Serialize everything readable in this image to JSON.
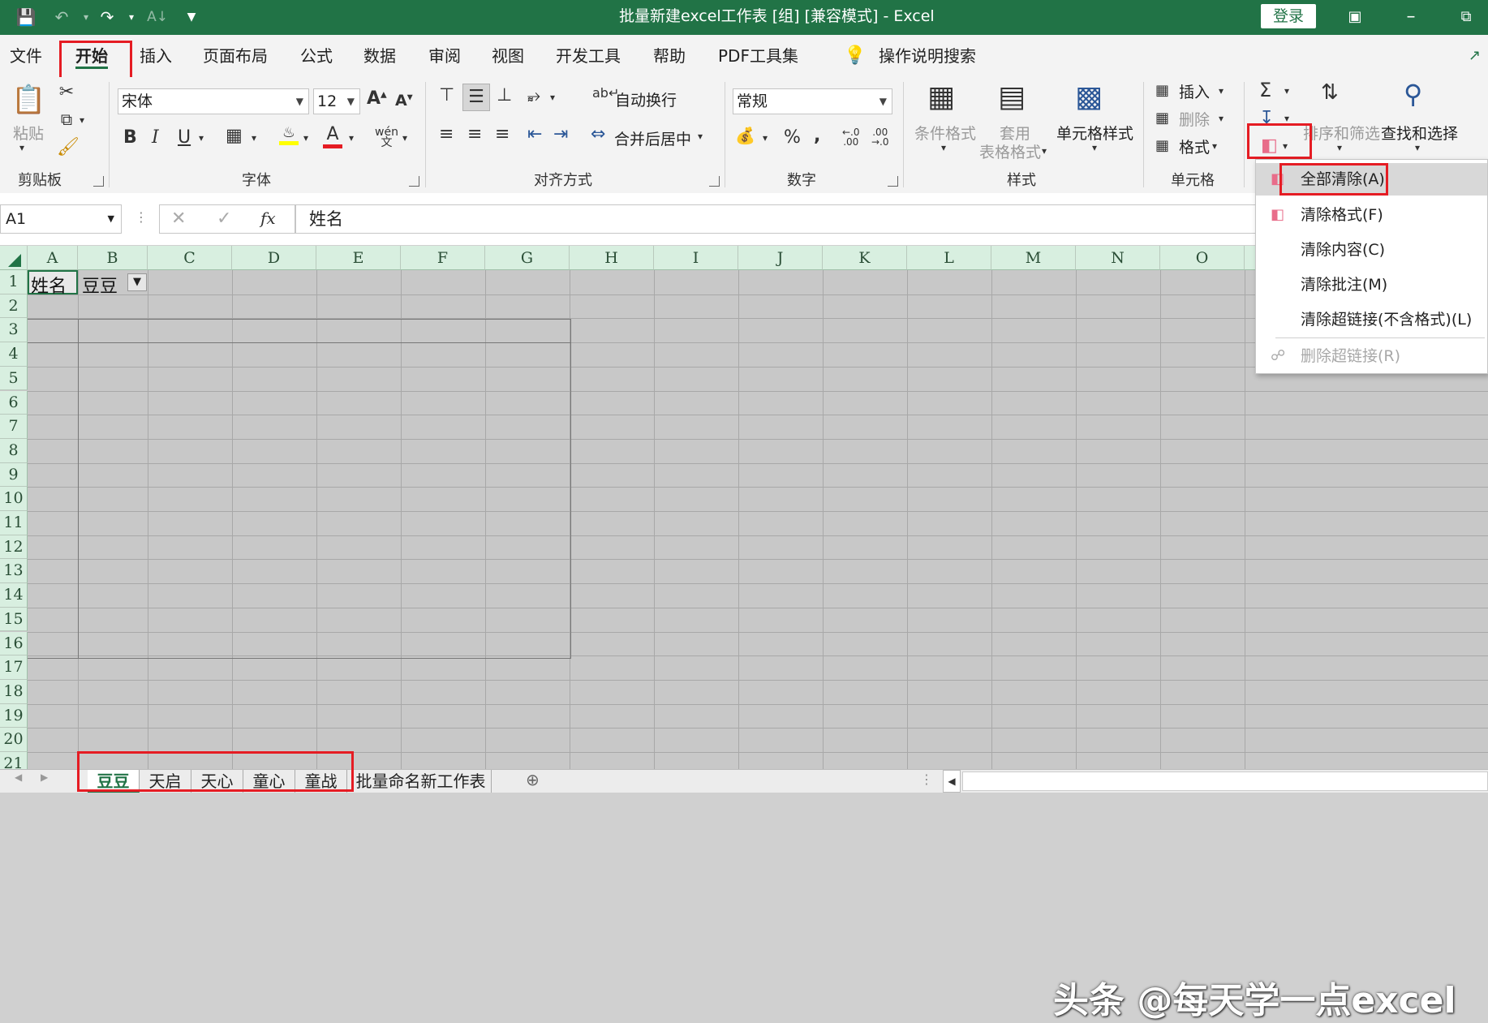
{
  "titlebar": {
    "title": "批量新建excel工作表 [组] [兼容模式] - Excel",
    "login": "登录"
  },
  "menu": [
    "文件",
    "开始",
    "插入",
    "页面布局",
    "公式",
    "数据",
    "审阅",
    "视图",
    "开发工具",
    "帮助",
    "PDF工具集"
  ],
  "menu_active": "开始",
  "search": {
    "placeholder": "操作说明搜索"
  },
  "ribbon": {
    "clipboard": {
      "paste": "粘贴",
      "label": "剪贴板"
    },
    "font": {
      "name": "宋体",
      "size": "12",
      "label": "字体"
    },
    "alignment": {
      "wrap": "自动换行",
      "merge": "合并后居中",
      "label": "对齐方式"
    },
    "number": {
      "format": "常规",
      "percent": "%",
      "comma": ",",
      "label": "数字"
    },
    "styles": {
      "conditional": "条件格式",
      "table_format_1": "套用",
      "table_format_2": "表格格式",
      "cell_styles": "单元格样式",
      "label": "样式"
    },
    "cells": {
      "insert": "插入",
      "delete": "删除",
      "format": "格式",
      "label": "单元格"
    },
    "editing": {
      "sort_filter": "排序和筛选",
      "find_select": "查找和选择"
    }
  },
  "formula_bar": {
    "name_box": "A1",
    "fx": "fx",
    "content": "姓名"
  },
  "columns": [
    "A",
    "B",
    "C",
    "D",
    "E",
    "F",
    "G",
    "H",
    "I",
    "J",
    "K",
    "L",
    "M",
    "N",
    "O"
  ],
  "rows": [
    "1",
    "2",
    "3",
    "4",
    "5",
    "6",
    "7",
    "8",
    "9",
    "10",
    "11",
    "12",
    "13",
    "14",
    "15",
    "16",
    "17",
    "18",
    "19",
    "20",
    "21"
  ],
  "cells": {
    "A1": "姓名",
    "B1": "豆豆"
  },
  "sheet_tabs": [
    "豆豆",
    "天启",
    "天心",
    "童心",
    "童战",
    "批量命名新工作表"
  ],
  "active_sheet": "豆豆",
  "clear_menu": [
    {
      "label": "全部清除(A)",
      "enabled": true,
      "highlight": true
    },
    {
      "label": "清除格式(F)",
      "enabled": true
    },
    {
      "label": "清除内容(C)",
      "enabled": true
    },
    {
      "label": "清除批注(M)",
      "enabled": true
    },
    {
      "label": "清除超链接(不含格式)(L)",
      "enabled": true
    },
    {
      "label": "删除超链接(R)",
      "enabled": false
    }
  ],
  "watermark": "头条 @每天学一点excel",
  "colors": {
    "excel_green": "#217346",
    "highlight_red": "#e51c23",
    "header_green": "#d8efe0"
  }
}
